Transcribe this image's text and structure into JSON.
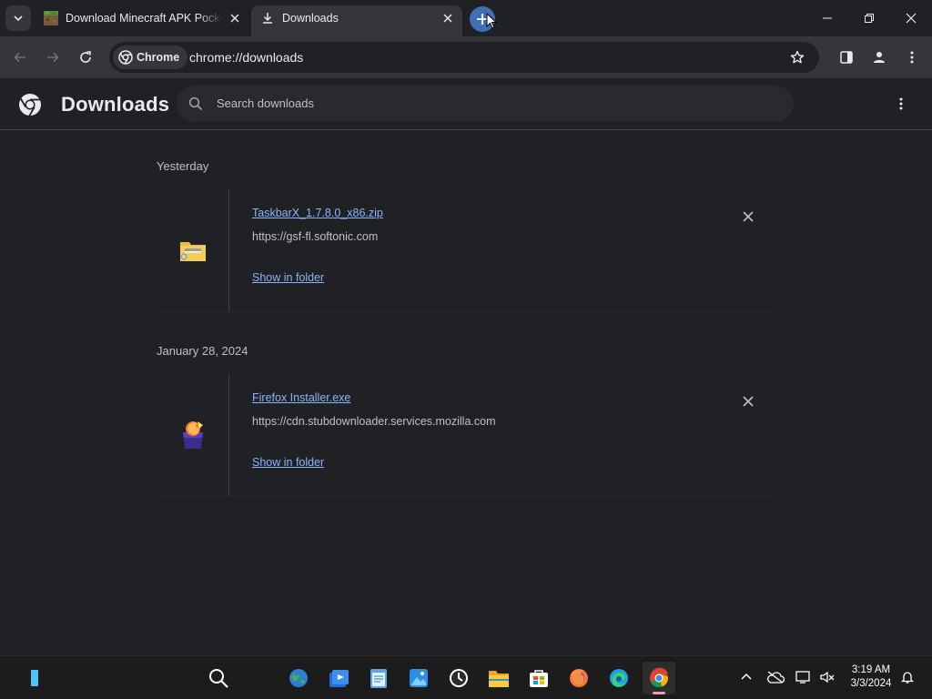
{
  "browser": {
    "tabs": [
      {
        "label": "Download Minecraft APK Pocke",
        "favicon": "minecraft-block-icon",
        "active": false
      },
      {
        "label": "Downloads",
        "favicon": "download-icon",
        "active": true
      }
    ],
    "chip_label": "Chrome",
    "url": "chrome://downloads",
    "accent": "#3f70b6"
  },
  "page": {
    "title": "Downloads",
    "search_placeholder": "Search downloads"
  },
  "downloads": [
    {
      "date": "Yesterday",
      "file_name": "TaskbarX_1.7.8.0_x86.zip",
      "source": "https://gsf-fl.softonic.com",
      "action": "Show in folder",
      "file_icon": "zip-folder-icon"
    },
    {
      "date": "January 28, 2024",
      "file_name": "Firefox Installer.exe",
      "source": "https://cdn.stubdownloader.services.mozilla.com",
      "action": "Show in folder",
      "file_icon": "firefox-installer-icon"
    }
  ],
  "taskbar": {
    "time": "3:19 AM",
    "date": "3/3/2024"
  },
  "colors": {
    "link": "#8ab4f8",
    "background": "#202124",
    "toolbar": "#35363a"
  }
}
